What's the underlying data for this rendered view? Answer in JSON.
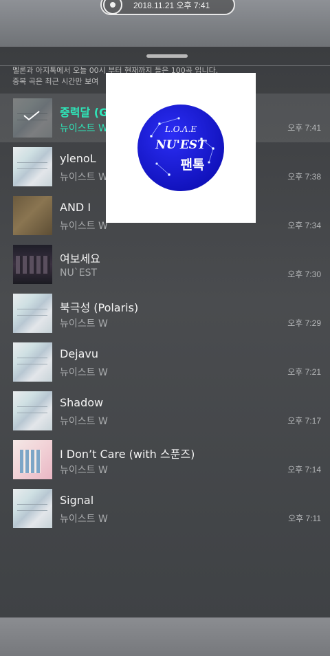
{
  "status": {
    "datetime": "2018.11.21 오후 7:41",
    "icon": "disc-icon"
  },
  "notice": {
    "line1": "멜론과 아지톡에서 오늘 00시 부터 현재까지 들은 100곡 입니다.",
    "line2": "중복 곡은 최근 시간만 보여"
  },
  "popup": {
    "line1": "L.O.Λ.E",
    "line2": "NU'EST",
    "line3": "팬톡",
    "bg_color": "#1c1ee8"
  },
  "tracks": [
    {
      "title": "중력달 (G",
      "artist": "뉴이스트 W",
      "time": "오후 7:41",
      "art": "whoyou",
      "current": true
    },
    {
      "title": "ylenoL",
      "artist": "뉴이스트 W",
      "time": "오후 7:38",
      "art": "whoyou"
    },
    {
      "title": "AND I",
      "artist": "뉴이스트 W",
      "time": "오후 7:34",
      "art": "andi"
    },
    {
      "title": "여보세요",
      "artist": "NU`EST",
      "time": "오후 7:30",
      "art": "hello"
    },
    {
      "title": "북극성 (Polaris)",
      "artist": "뉴이스트 W",
      "time": "오후 7:29",
      "art": "whoyou"
    },
    {
      "title": "Dejavu",
      "artist": "뉴이스트 W",
      "time": "오후 7:21",
      "art": "whoyou"
    },
    {
      "title": "Shadow",
      "artist": "뉴이스트 W",
      "time": "오후 7:17",
      "art": "whoyou"
    },
    {
      "title": "I Don’t Care (with 스푼즈)",
      "artist": "뉴이스트 W",
      "time": "오후 7:14",
      "art": "idc"
    },
    {
      "title": "Signal",
      "artist": "뉴이스트 W",
      "time": "오후 7:11",
      "art": "whoyou"
    }
  ],
  "colors": {
    "accent": "#2ee6b9"
  }
}
